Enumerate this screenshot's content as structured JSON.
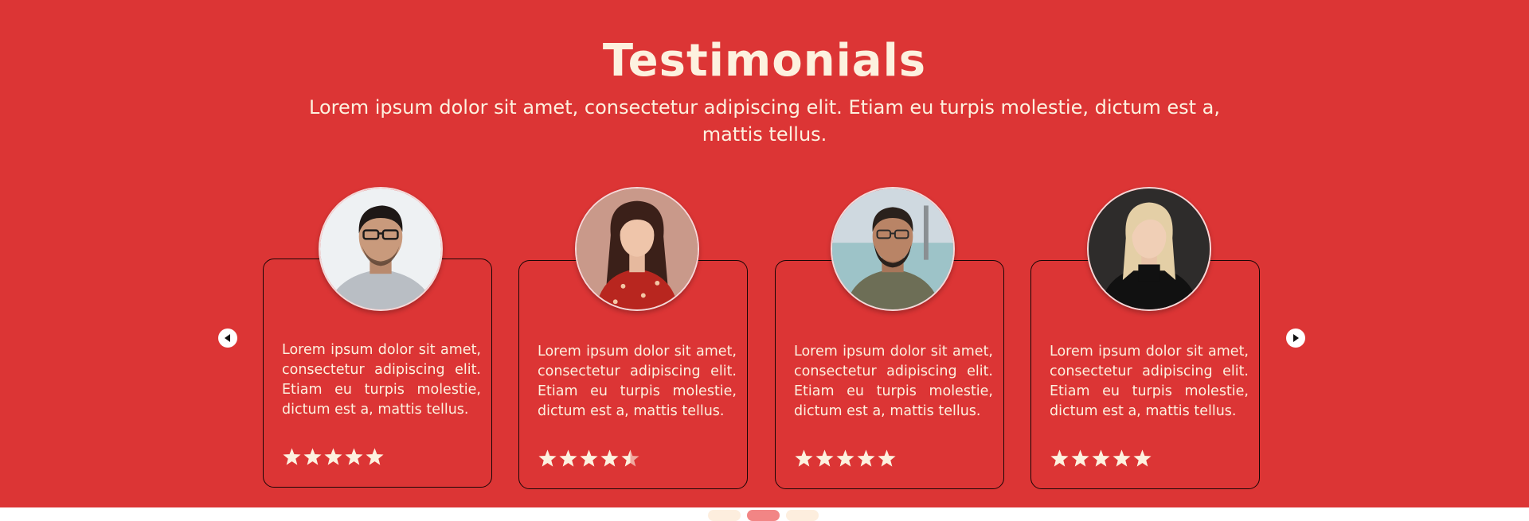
{
  "header": {
    "title": "Testimonials",
    "subtitle": "Lorem ipsum dolor sit amet, consectetur adipiscing elit. Etiam eu turpis molestie, dictum est a, mattis tellus."
  },
  "testimonials": [
    {
      "text": "Lorem ipsum dolor sit amet, consectetur adipiscing elit. Etiam eu turpis molestie, dictum est a, mattis tellus.",
      "rating": 5
    },
    {
      "text": "Lorem ipsum dolor sit amet, consectetur adipiscing elit. Etiam eu turpis molestie, dictum est a, mattis tellus.",
      "rating": 4.5
    },
    {
      "text": "Lorem ipsum dolor sit amet, consectetur adipiscing elit. Etiam eu turpis molestie, dictum est a, mattis tellus.",
      "rating": 5
    },
    {
      "text": "Lorem ipsum dolor sit amet, consectetur adipiscing elit. Etiam eu turpis molestie, dictum est a, mattis tellus.",
      "rating": 5
    }
  ],
  "carousel": {
    "prev_icon": "caret-left-icon",
    "next_icon": "caret-right-icon",
    "page_count": 3,
    "active_page": 2
  },
  "colors": {
    "background": "#dc3535",
    "text": "#fdf1df",
    "star": "#fdf1df",
    "dot_inactive": "#fdeede",
    "dot_active": "#f28585"
  }
}
